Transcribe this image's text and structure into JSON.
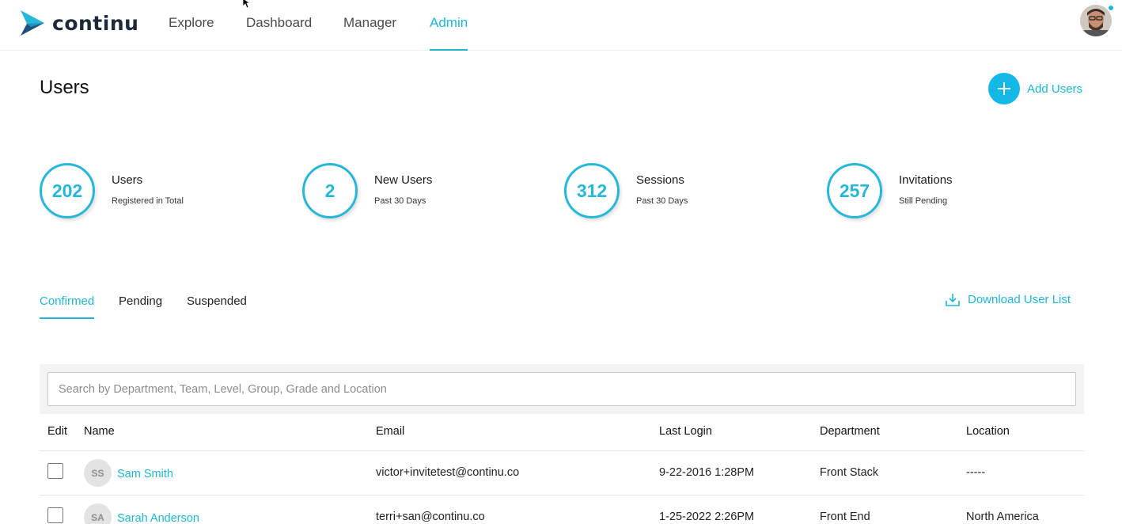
{
  "brand": {
    "name": "continu",
    "accent": "#1fb6d6"
  },
  "nav": {
    "items": [
      {
        "label": "Explore"
      },
      {
        "label": "Dashboard"
      },
      {
        "label": "Manager"
      },
      {
        "label": "Admin",
        "active": true
      }
    ]
  },
  "header": {
    "title": "Users",
    "add_users_label": "Add Users"
  },
  "stats": [
    {
      "value": "202",
      "title": "Users",
      "subtitle": "Registered in Total"
    },
    {
      "value": "2",
      "title": "New Users",
      "subtitle": "Past 30 Days"
    },
    {
      "value": "312",
      "title": "Sessions",
      "subtitle": "Past 30 Days"
    },
    {
      "value": "257",
      "title": "Invitations",
      "subtitle": "Still Pending"
    }
  ],
  "tabs": [
    {
      "label": "Confirmed",
      "active": true
    },
    {
      "label": "Pending"
    },
    {
      "label": "Suspended"
    }
  ],
  "download_label": "Download User List",
  "search": {
    "placeholder": "Search by Department, Team, Level, Group, Grade and Location",
    "value": ""
  },
  "table": {
    "columns": [
      "Edit",
      "Name",
      "Email",
      "Last Login",
      "Department",
      "Location"
    ],
    "rows": [
      {
        "initials": "SS",
        "name": "Sam Smith",
        "email": "victor+invitetest@continu.co",
        "last_login": "9-22-2016 1:28PM",
        "department": "Front Stack",
        "location": "-----"
      },
      {
        "initials": "SA",
        "name": "Sarah Anderson",
        "email": "terri+san@continu.co",
        "last_login": "1-25-2022 2:26PM",
        "department": "Front End",
        "location": "North America"
      }
    ]
  }
}
